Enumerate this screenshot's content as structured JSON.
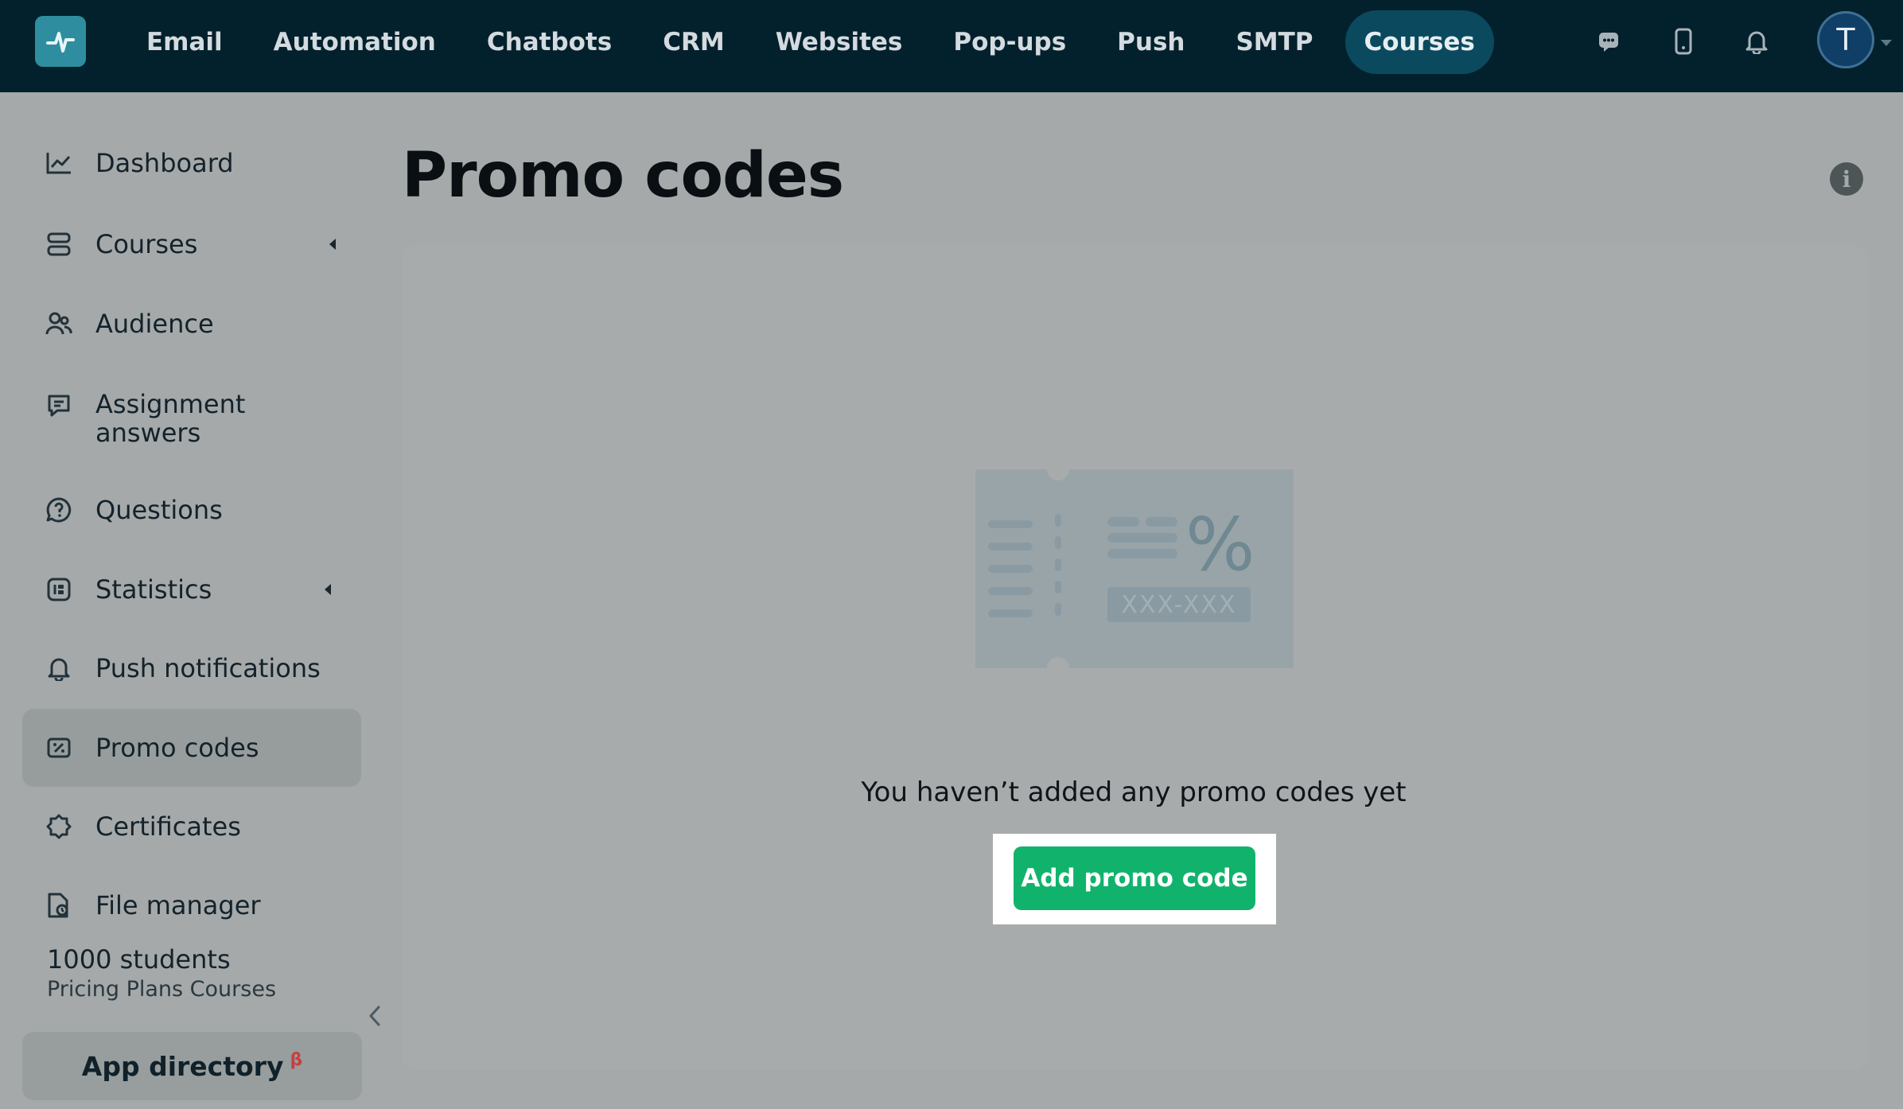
{
  "topnav": {
    "items": [
      {
        "label": "Email"
      },
      {
        "label": "Automation"
      },
      {
        "label": "Chatbots"
      },
      {
        "label": "CRM"
      },
      {
        "label": "Websites"
      },
      {
        "label": "Pop-ups"
      },
      {
        "label": "Push"
      },
      {
        "label": "SMTP"
      },
      {
        "label": "Courses",
        "active": true
      }
    ],
    "icons": [
      "chat-icon",
      "mobile-icon",
      "bell-icon"
    ],
    "avatar_initial": "T"
  },
  "sidebar": {
    "items": [
      {
        "label": "Dashboard",
        "icon": "chart-line-icon"
      },
      {
        "label": "Courses",
        "icon": "layers-icon",
        "expandable": true
      },
      {
        "label": "Audience",
        "icon": "users-icon"
      },
      {
        "label": "Assignment answers",
        "icon": "comment-check-icon"
      },
      {
        "label": "Questions",
        "icon": "question-bubble-icon"
      },
      {
        "label": "Statistics",
        "icon": "stats-icon",
        "expandable": true
      },
      {
        "label": "Push notifications",
        "icon": "bell-icon"
      },
      {
        "label": "Promo codes",
        "icon": "coupon-icon",
        "active": true
      },
      {
        "label": "Certificates",
        "icon": "badge-icon"
      },
      {
        "label": "File manager",
        "icon": "file-icon"
      }
    ],
    "plan": {
      "title": "1000 students",
      "subtitle": "Pricing Plans Courses"
    },
    "app_directory": {
      "label": "App directory",
      "badge": "β"
    }
  },
  "main": {
    "title": "Promo codes",
    "empty_state": {
      "message": "You haven’t added any promo codes yet",
      "illustration_code": "XXX-XXX",
      "illustration_symbol": "%",
      "button_label": "Add promo code"
    }
  },
  "colors": {
    "topnav_bg": "#03212c",
    "active_tab": "#0b4a5e",
    "primary_button": "#11b36c",
    "beta_badge": "#c64040"
  }
}
